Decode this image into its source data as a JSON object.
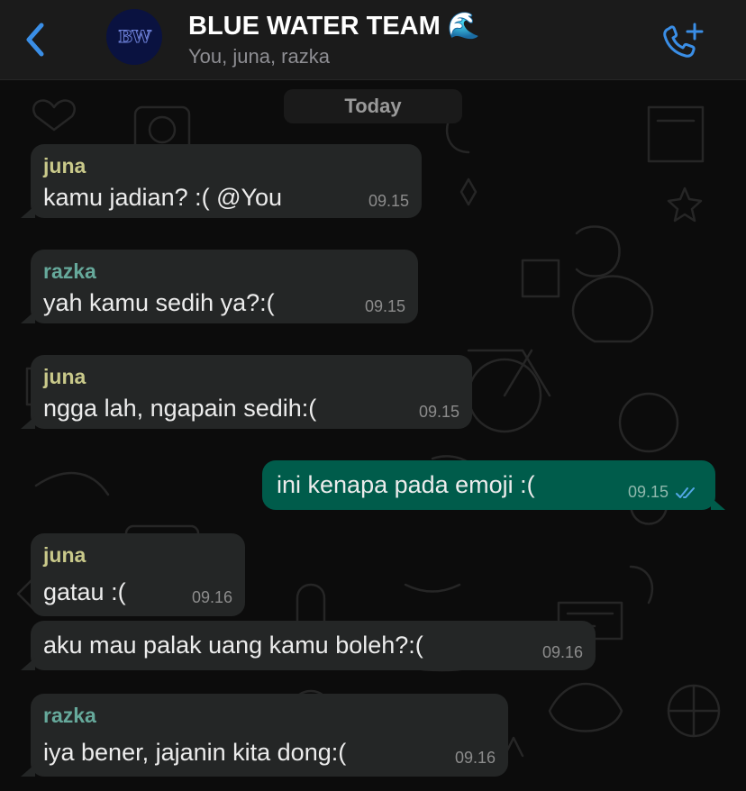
{
  "header": {
    "back_icon": "chevron-left-icon",
    "avatar_text": "BW",
    "title": "BLUE WATER TEAM 🌊",
    "members": "You, juna, razka",
    "call_icon": "add-call-icon",
    "accent_color": "#3a8ee6"
  },
  "chat": {
    "date_label": "Today",
    "messages": [
      {
        "direction": "incoming",
        "sender": "juna",
        "text": "kamu jadian? :( @You",
        "time": "09.15"
      },
      {
        "direction": "incoming",
        "sender": "razka",
        "text": "yah kamu sedih ya?:(",
        "time": "09.15"
      },
      {
        "direction": "incoming",
        "sender": "juna",
        "text": "ngga lah, ngapain sedih:(",
        "time": "09.15"
      },
      {
        "direction": "outgoing",
        "sender": "",
        "text": "ini kenapa pada emoji :(",
        "time": "09.15",
        "status": "read"
      },
      {
        "direction": "incoming",
        "sender": "juna",
        "text": "gatau :(",
        "time": "09.16"
      },
      {
        "direction": "incoming",
        "sender": "",
        "text": "aku mau palak uang kamu boleh?:(",
        "time": "09.16"
      },
      {
        "direction": "incoming",
        "sender": "razka",
        "text": "iya bener, jajanin kita dong:(",
        "time": "09.16"
      }
    ]
  },
  "colors": {
    "juna": "#c9c98a",
    "razka": "#66a99b",
    "incoming_bubble": "#242626",
    "outgoing_bubble": "#005c4b",
    "read_ticks": "#53a7e6"
  }
}
